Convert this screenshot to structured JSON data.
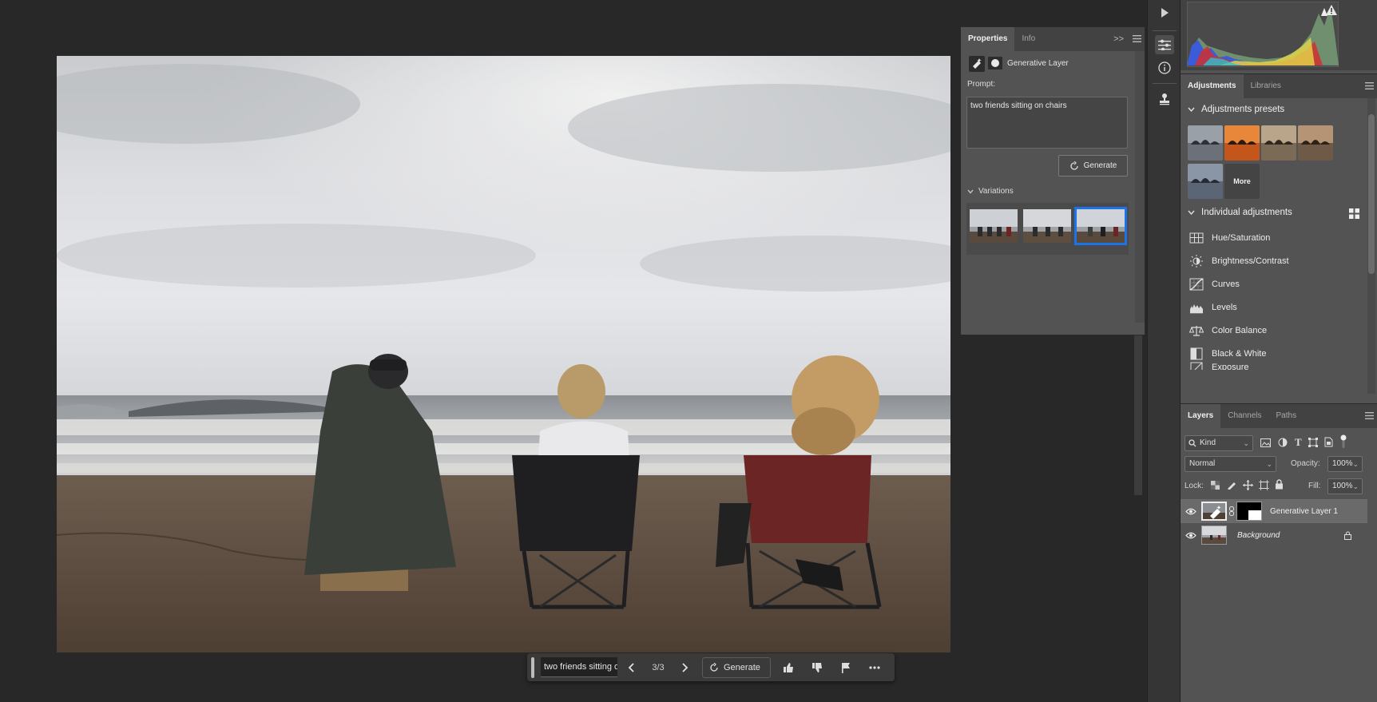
{
  "canvas": {
    "image_alt": "Three people sitting on a beach facing the ocean"
  },
  "taskbar": {
    "prompt_value": "two friends sitting on",
    "counter": "3/3",
    "generate_label": "Generate"
  },
  "properties": {
    "tabs": [
      "Properties",
      "Info"
    ],
    "layer_type": "Generative Layer",
    "prompt_label": "Prompt:",
    "prompt_value": "two friends sitting on chairs",
    "generate_label": "Generate",
    "variations_label": "Variations",
    "selected_variation": 3,
    "accent": "#1b73e8"
  },
  "adjustments": {
    "tabs": [
      "Adjustments",
      "Libraries"
    ],
    "presets_title": "Adjustments presets",
    "more_label": "More",
    "individual_title": "Individual adjustments",
    "items": [
      "Hue/Saturation",
      "Brightness/Contrast",
      "Curves",
      "Levels",
      "Color Balance",
      "Black & White",
      "Exposure"
    ]
  },
  "layers": {
    "tabs": [
      "Layers",
      "Channels",
      "Paths"
    ],
    "filter_kind": "Kind",
    "blend_mode": "Normal",
    "opacity_label": "Opacity:",
    "opacity_value": "100%",
    "lock_label": "Lock:",
    "fill_label": "Fill:",
    "fill_value": "100%",
    "rows": [
      {
        "name": "Generative Layer 1",
        "selected": true
      },
      {
        "name": "Background",
        "selected": false
      }
    ]
  }
}
